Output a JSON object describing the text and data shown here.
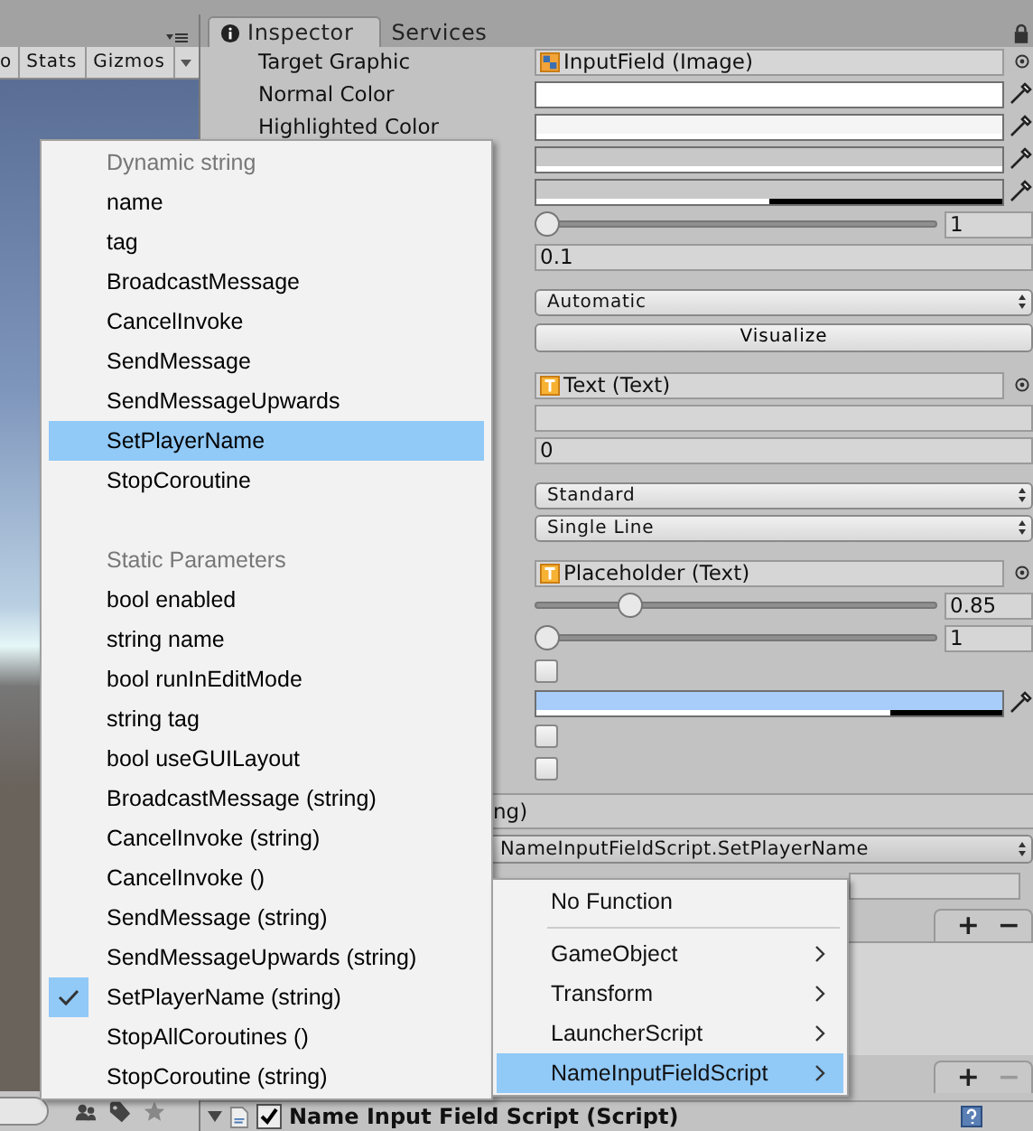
{
  "scene_toolbar": {
    "buttons": [
      {
        "label": "o"
      },
      {
        "label": "Stats"
      },
      {
        "label": "Gizmos"
      }
    ]
  },
  "inspector": {
    "tabs": [
      {
        "label": "Inspector",
        "selected": true
      },
      {
        "label": "Services",
        "selected": false
      }
    ],
    "sections": [
      {
        "rows": [
          {
            "kind": "image_object",
            "label": "Target Graphic",
            "value": "InputField (Image)"
          },
          {
            "kind": "color",
            "label": "Normal Color",
            "color": "#ffffff",
            "level": 1
          },
          {
            "kind": "color",
            "label": "Highlighted Color",
            "color": "#f5f5f5",
            "level": 1
          },
          {
            "kind": "color",
            "color": "#c8c8c8",
            "level": 1
          },
          {
            "kind": "color",
            "color": "#c8c8c8",
            "level": 0.5
          },
          {
            "kind": "slider",
            "level": 0,
            "value": "1"
          },
          {
            "kind": "number",
            "value": "0.1"
          }
        ]
      },
      {
        "rows": [
          {
            "kind": "dropdown",
            "value": "Automatic"
          },
          {
            "kind": "button",
            "value": "Visualize"
          }
        ]
      },
      {
        "rows": [
          {
            "kind": "text_object",
            "value": "Text (Text)"
          },
          {
            "kind": "text"
          },
          {
            "kind": "number",
            "value": "0"
          }
        ]
      },
      {
        "rows": [
          {
            "kind": "dropdown",
            "value": "Standard"
          },
          {
            "kind": "dropdown",
            "value": "Single Line"
          }
        ]
      },
      {
        "rows": [
          {
            "kind": "text_object",
            "value": "Placeholder (Text)"
          },
          {
            "kind": "slider",
            "level": 0.22,
            "value": "0.85"
          },
          {
            "kind": "slider",
            "level": 0,
            "value": "1"
          },
          {
            "kind": "checkbox",
            "checked": false
          },
          {
            "kind": "color",
            "color": "#a8cdfa",
            "level": 0.76
          },
          {
            "kind": "checkbox",
            "checked": false
          },
          {
            "kind": "checkbox",
            "checked": false
          }
        ]
      }
    ],
    "event": {
      "label_tail": "ng)",
      "function": "NameInputFieldScript.SetPlayerName",
      "footers": [
        [
          {
            "label": "+",
            "disabled": false
          },
          {
            "label": "−",
            "disabled": false
          }
        ],
        [
          {
            "label": "+",
            "disabled": false
          },
          {
            "label": "−",
            "disabled": true
          }
        ]
      ]
    },
    "component": {
      "title": "Name Input Field Script (Script)",
      "enabled": true
    }
  },
  "function_menu": {
    "items": [
      {
        "kind": "header",
        "label": "Dynamic string"
      },
      {
        "kind": "item",
        "label": "name",
        "highlighted": false,
        "checked": false
      },
      {
        "kind": "item",
        "label": "tag",
        "highlighted": false,
        "checked": false
      },
      {
        "kind": "item",
        "label": "BroadcastMessage",
        "highlighted": false,
        "checked": false
      },
      {
        "kind": "item",
        "label": "CancelInvoke",
        "highlighted": false,
        "checked": false
      },
      {
        "kind": "item",
        "label": "SendMessage",
        "highlighted": false,
        "checked": false
      },
      {
        "kind": "item",
        "label": "SendMessageUpwards",
        "highlighted": false,
        "checked": false
      },
      {
        "kind": "item",
        "label": "SetPlayerName",
        "highlighted": true,
        "checked": false
      },
      {
        "kind": "item",
        "label": "StopCoroutine",
        "highlighted": false,
        "checked": false
      },
      {
        "kind": "spacer"
      },
      {
        "kind": "header",
        "label": "Static Parameters"
      },
      {
        "kind": "item",
        "label": "bool enabled",
        "highlighted": false,
        "checked": false
      },
      {
        "kind": "item",
        "label": "string name",
        "highlighted": false,
        "checked": false
      },
      {
        "kind": "item",
        "label": "bool runInEditMode",
        "highlighted": false,
        "checked": false
      },
      {
        "kind": "item",
        "label": "string tag",
        "highlighted": false,
        "checked": false
      },
      {
        "kind": "item",
        "label": "bool useGUILayout",
        "highlighted": false,
        "checked": false
      },
      {
        "kind": "item",
        "label": "BroadcastMessage (string)",
        "highlighted": false,
        "checked": false
      },
      {
        "kind": "item",
        "label": "CancelInvoke (string)",
        "highlighted": false,
        "checked": false
      },
      {
        "kind": "item",
        "label": "CancelInvoke ()",
        "highlighted": false,
        "checked": false
      },
      {
        "kind": "item",
        "label": "SendMessage (string)",
        "highlighted": false,
        "checked": false
      },
      {
        "kind": "item",
        "label": "SendMessageUpwards (string)",
        "highlighted": false,
        "checked": false
      },
      {
        "kind": "item",
        "label": "SetPlayerName (string)",
        "highlighted": false,
        "checked": true
      },
      {
        "kind": "item",
        "label": "StopAllCoroutines ()",
        "highlighted": false,
        "checked": false
      },
      {
        "kind": "item",
        "label": "StopCoroutine (string)",
        "highlighted": false,
        "checked": false
      }
    ]
  },
  "object_menu": {
    "items": [
      {
        "kind": "item",
        "label": "No Function",
        "highlighted": false,
        "submenu": false
      },
      {
        "kind": "separator"
      },
      {
        "kind": "item",
        "label": "GameObject",
        "highlighted": false,
        "submenu": true
      },
      {
        "kind": "item",
        "label": "Transform",
        "highlighted": false,
        "submenu": true
      },
      {
        "kind": "item",
        "label": "LauncherScript",
        "highlighted": false,
        "submenu": true
      },
      {
        "kind": "item",
        "label": "NameInputFieldScript",
        "highlighted": true,
        "submenu": true
      }
    ]
  }
}
